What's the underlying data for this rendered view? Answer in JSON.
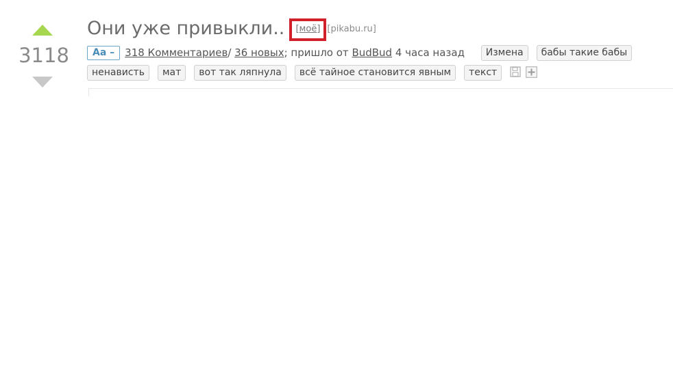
{
  "post": {
    "score": "3118",
    "title": "Они уже привыкли..",
    "moe_label": "[моё]",
    "source": "[pikabu.ru]",
    "font_toggle": "Aa –",
    "comments_link": "318 Комментариев",
    "separator": "/",
    "new_link": "36 новых",
    "from_text": "; пришло от",
    "author": "BudBud",
    "time_text": "4 часа назад",
    "tags_row1": [
      "Измена",
      "бабы такие бабы"
    ],
    "tags_row2": [
      "ненависть",
      "мат",
      "вот так ляпнула",
      "всё тайное становится явным",
      "текст"
    ]
  },
  "colors": {
    "upvote": "#a6d74f",
    "downvote": "#c8c8c8",
    "highlight": "#d0202a",
    "accent": "#4a8db6"
  },
  "icons": {
    "save": "save-icon",
    "add": "plus-icon"
  }
}
